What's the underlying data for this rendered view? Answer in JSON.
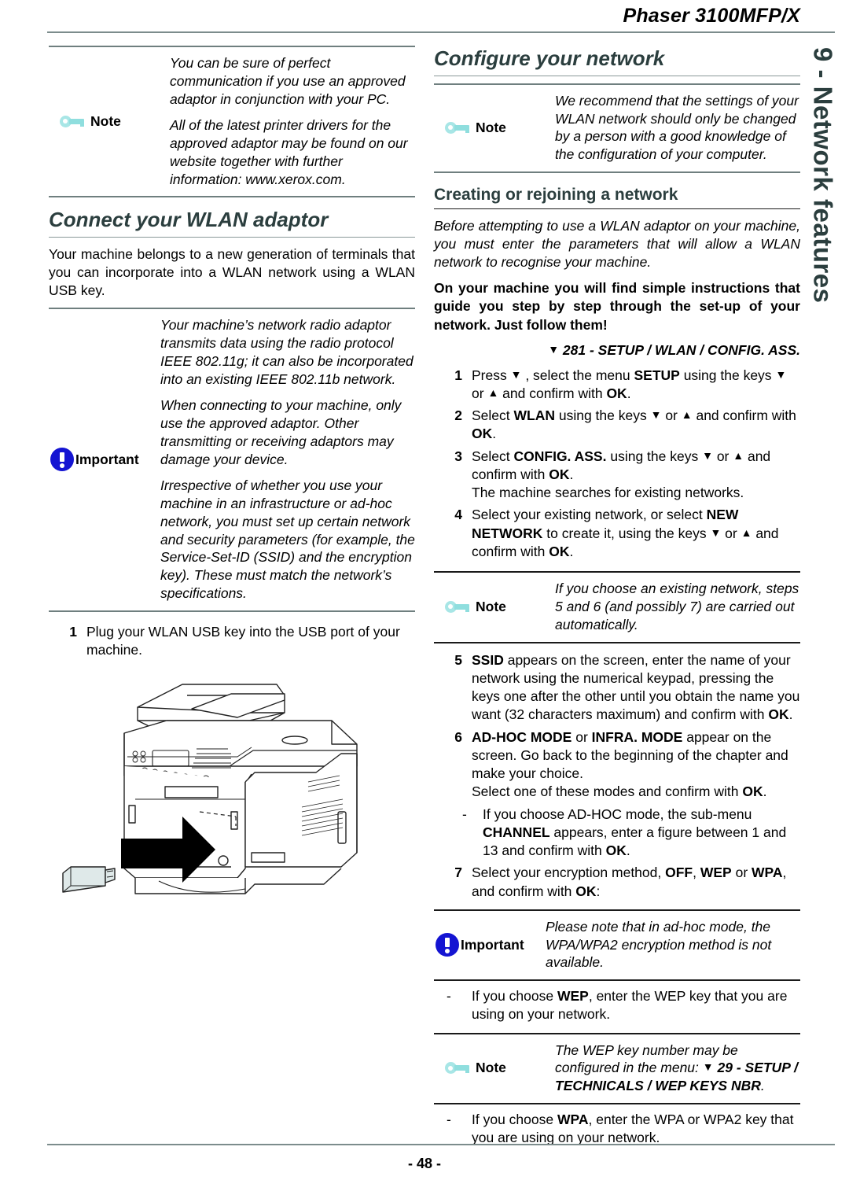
{
  "header": {
    "title": "Phaser 3100MFP/X"
  },
  "side_tab": {
    "label": "9 - Network features"
  },
  "footer": {
    "page_number": "- 48 -"
  },
  "left_column": {
    "note_top": {
      "label": "Note",
      "icon": "key-icon",
      "paragraphs": [
        "You can be sure of perfect communication if you use an approved adaptor in conjunction with your PC.",
        "All of the latest printer drivers for the approved adaptor may be found on our website together with further information: www.xerox.com."
      ]
    },
    "heading": "Connect your WLAN adaptor",
    "intro": "Your machine belongs to a new generation of terminals that you can incorporate into a WLAN network using a WLAN USB key.",
    "important": {
      "label": "Important",
      "icon": "exclamation-circle-icon",
      "paragraphs": [
        "Your machine’s network radio adaptor transmits data using the radio protocol IEEE 802.11g; it can also be incorporated into an existing IEEE 802.11b network.",
        "When connecting to your machine, only use the approved adaptor. Other transmitting or receiving adaptors may damage your device.",
        "Irrespective of whether you use your machine in an infrastructure or ad-hoc network, you must set up certain network and security parameters (for example, the Service-Set-ID (SSID) and the encryption key). These must match the network’s specifications."
      ]
    },
    "step1": {
      "number": "1",
      "text": "Plug your WLAN USB key into the USB port of your machine."
    },
    "illustration": {
      "name": "printer-usb-key-illustration",
      "caption": ""
    }
  },
  "right_column": {
    "heading": "Configure your network",
    "note_top": {
      "label": "Note",
      "icon": "key-icon",
      "paragraphs": [
        "We recommend that the settings of your WLAN network should only be changed by a person with a good knowledge of the configuration of your computer."
      ]
    },
    "subheading": "Creating or rejoining a network",
    "intro_italic": "Before attempting to use a WLAN adaptor on your machine, you must enter the parameters that will allow a WLAN network to recognise your machine.",
    "intro_bold": "On your machine you will find simple instructions that guide you step by step through the set-up of your network. Just follow them!",
    "menu_path": "281 - SETUP / WLAN / CONFIG. ASS.",
    "menu_path_icon": "down-triangle-icon",
    "steps_1_4": [
      {
        "number": "1",
        "html": "Press <span class=\"tri\">▼</span> , select the menu <b>SETUP</b> using the keys <span class=\"tri\">▼</span> or <span class=\"tri\">▲</span> and confirm with <b>OK</b>."
      },
      {
        "number": "2",
        "html": "Select <b>WLAN</b> using the keys <span class=\"tri\">▼</span> or <span class=\"tri\">▲</span> and confirm with <b>OK</b>."
      },
      {
        "number": "3",
        "html": "Select <b>CONFIG. ASS.</b> using the keys <span class=\"tri\">▼</span> or <span class=\"tri\">▲</span> and confirm with <b>OK</b>.<br>The machine searches for existing networks."
      },
      {
        "number": "4",
        "html": "Select your existing network, or select <b>NEW NETWORK</b> to create it, using the keys <span class=\"tri\">▼</span> or <span class=\"tri\">▲</span> and confirm with <b>OK</b>."
      }
    ],
    "note_mid": {
      "label": "Note",
      "icon": "key-icon",
      "paragraphs": [
        "If you choose an existing network, steps 5 and 6 (and possibly 7) are carried out automatically."
      ]
    },
    "steps_5_7": [
      {
        "number": "5",
        "html": "<b>SSID</b> appears on the screen, enter the name of your network using the numerical keypad, pressing the keys one after the other until you obtain the name you want (32 characters maximum) and confirm with <b>OK</b>."
      },
      {
        "number": "6",
        "html": "<b>AD-HOC MODE</b> or <b>INFRA. MODE</b> appear on the screen. Go back to the beginning of the chapter and make your choice.<br>Select one of these modes and confirm with <b>OK</b>."
      }
    ],
    "step6_dash": {
      "dash": "-",
      "html": "If you choose AD-HOC mode, the sub-menu <b>CHANNEL</b> appears, enter a figure between 1 and 13 and confirm with <b>OK</b>."
    },
    "step7": {
      "number": "7",
      "html": "Select your encryption method, <b>OFF</b>, <b>WEP</b> or <b>WPA</b>, and confirm with <b>OK</b>:"
    },
    "important_bottom": {
      "label": "Important",
      "icon": "exclamation-circle-icon",
      "paragraphs": [
        "Please note that in ad-hoc mode, the WPA/WPA2 encryption method is not available."
      ]
    },
    "dash_wep": {
      "dash": "-",
      "html": "If you choose <b>WEP</b>, enter the WEP key that you are using on your network."
    },
    "note_bottom": {
      "label": "Note",
      "icon": "key-icon",
      "html": "The WEP key number may be configured in the menu: <span class=\"tri\">▼</span> <b>29 - SETUP / TECHNICALS / WEP KEYS NBR</b>."
    },
    "dash_wpa": {
      "dash": "-",
      "html": "If you choose <b>WPA</b>, enter the WPA or WPA2 key that you are using on your network."
    }
  },
  "colors": {
    "heading": "#2b3e3e",
    "rule": "#6f7f7f",
    "note_icon": "#8fdede",
    "important_icon": "#1414d2"
  }
}
